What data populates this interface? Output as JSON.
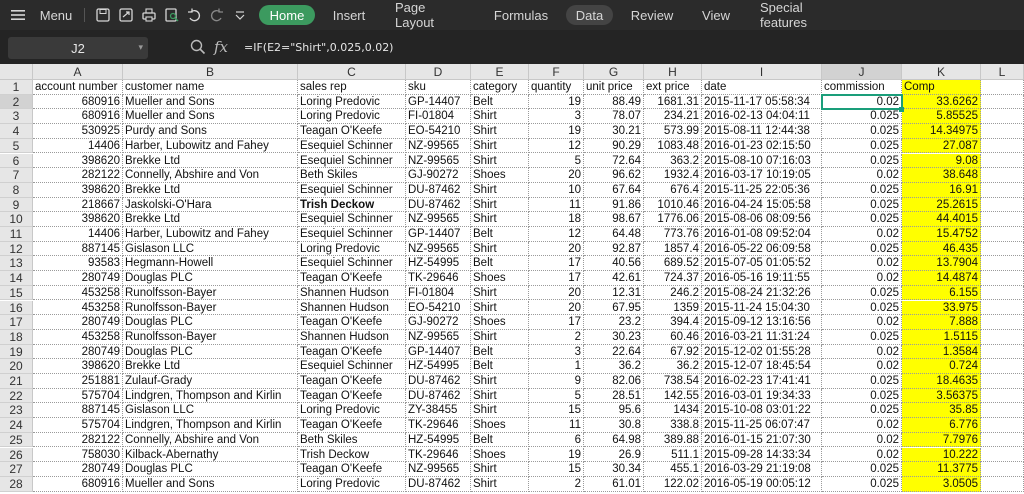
{
  "toolbar": {
    "menu_label": "Menu",
    "tabs": [
      "Home",
      "Insert",
      "Page Layout",
      "Formulas",
      "Data",
      "Review",
      "View",
      "Special features"
    ],
    "active_tab": "Home",
    "accent": "#3c9a5f"
  },
  "formula_bar": {
    "cell_ref": "J2",
    "fx_label": "fx",
    "formula": "=IF(E2=\"Shirt\",0.025,0.02)"
  },
  "sheet": {
    "columns": [
      "A",
      "B",
      "C",
      "D",
      "E",
      "F",
      "G",
      "H",
      "I",
      "J",
      "K",
      "L"
    ],
    "selected_column": "J",
    "selected_row": 2,
    "highlight_color": "#ffff00",
    "rows": [
      {
        "n": "1",
        "c": [
          "account number",
          "customer name",
          "sales rep",
          "sku",
          "category",
          "quantity",
          "unit price",
          "ext price",
          "date",
          "commission",
          "Comp"
        ]
      },
      {
        "n": "2",
        "c": [
          "680916",
          "Mueller and Sons",
          "Loring Predovic",
          "GP-14407",
          "Belt",
          "19",
          "88.49",
          "1681.31",
          "2015-11-17 05:58:34",
          "0.02",
          "33.6262"
        ]
      },
      {
        "n": "3",
        "c": [
          "680916",
          "Mueller and Sons",
          "Loring Predovic",
          "FI-01804",
          "Shirt",
          "3",
          "78.07",
          "234.21",
          "2016-02-13 04:04:11",
          "0.025",
          "5.85525"
        ]
      },
      {
        "n": "4",
        "c": [
          "530925",
          "Purdy and Sons",
          "Teagan O'Keefe",
          "EO-54210",
          "Shirt",
          "19",
          "30.21",
          "573.99",
          "2015-08-11 12:44:38",
          "0.025",
          "14.34975"
        ]
      },
      {
        "n": "5",
        "c": [
          "14406",
          "Harber, Lubowitz and Fahey",
          "Esequiel Schinner",
          "NZ-99565",
          "Shirt",
          "12",
          "90.29",
          "1083.48",
          "2016-01-23 02:15:50",
          "0.025",
          "27.087"
        ]
      },
      {
        "n": "6",
        "c": [
          "398620",
          "Brekke Ltd",
          "Esequiel Schinner",
          "NZ-99565",
          "Shirt",
          "5",
          "72.64",
          "363.2",
          "2015-08-10 07:16:03",
          "0.025",
          "9.08"
        ]
      },
      {
        "n": "7",
        "c": [
          "282122",
          "Connelly, Abshire and Von",
          "Beth Skiles",
          "GJ-90272",
          "Shoes",
          "20",
          "96.62",
          "1932.4",
          "2016-03-17 10:19:05",
          "0.02",
          "38.648"
        ]
      },
      {
        "n": "8",
        "c": [
          "398620",
          "Brekke Ltd",
          "Esequiel Schinner",
          "DU-87462",
          "Shirt",
          "10",
          "67.64",
          "676.4",
          "2015-11-25 22:05:36",
          "0.025",
          "16.91"
        ]
      },
      {
        "n": "9",
        "c": [
          "218667",
          "Jaskolski-O'Hara",
          "Trish Deckow",
          "DU-87462",
          "Shirt",
          "11",
          "91.86",
          "1010.46",
          "2016-04-24 15:05:58",
          "0.025",
          "25.2615"
        ],
        "bold": 2
      },
      {
        "n": "10",
        "c": [
          "398620",
          "Brekke Ltd",
          "Esequiel Schinner",
          "NZ-99565",
          "Shirt",
          "18",
          "98.67",
          "1776.06",
          "2015-08-06 08:09:56",
          "0.025",
          "44.4015"
        ]
      },
      {
        "n": "11",
        "c": [
          "14406",
          "Harber, Lubowitz and Fahey",
          "Esequiel Schinner",
          "GP-14407",
          "Belt",
          "12",
          "64.48",
          "773.76",
          "2016-01-08 09:52:04",
          "0.02",
          "15.4752"
        ]
      },
      {
        "n": "12",
        "c": [
          "887145",
          "Gislason LLC",
          "Loring Predovic",
          "NZ-99565",
          "Shirt",
          "20",
          "92.87",
          "1857.4",
          "2016-05-22 06:09:58",
          "0.025",
          "46.435"
        ]
      },
      {
        "n": "13",
        "c": [
          "93583",
          "Hegmann-Howell",
          "Esequiel Schinner",
          "HZ-54995",
          "Belt",
          "17",
          "40.56",
          "689.52",
          "2015-07-05 01:05:52",
          "0.02",
          "13.7904"
        ]
      },
      {
        "n": "14",
        "c": [
          "280749",
          "Douglas PLC",
          "Teagan O'Keefe",
          "TK-29646",
          "Shoes",
          "17",
          "42.61",
          "724.37",
          "2016-05-16 19:11:55",
          "0.02",
          "14.4874"
        ]
      },
      {
        "n": "15",
        "c": [
          "453258",
          "Runolfsson-Bayer",
          "Shannen Hudson",
          "FI-01804",
          "Shirt",
          "20",
          "12.31",
          "246.2",
          "2015-08-24 21:32:26",
          "0.025",
          "6.155"
        ]
      },
      {
        "n": "16",
        "c": [
          "453258",
          "Runolfsson-Bayer",
          "Shannen Hudson",
          "EO-54210",
          "Shirt",
          "20",
          "67.95",
          "1359",
          "2015-11-24 15:04:30",
          "0.025",
          "33.975"
        ]
      },
      {
        "n": "17",
        "c": [
          "280749",
          "Douglas PLC",
          "Teagan O'Keefe",
          "GJ-90272",
          "Shoes",
          "17",
          "23.2",
          "394.4",
          "2015-09-12 13:16:56",
          "0.02",
          "7.888"
        ]
      },
      {
        "n": "18",
        "c": [
          "453258",
          "Runolfsson-Bayer",
          "Shannen Hudson",
          "NZ-99565",
          "Shirt",
          "2",
          "30.23",
          "60.46",
          "2016-03-21 11:31:24",
          "0.025",
          "1.5115"
        ]
      },
      {
        "n": "19",
        "c": [
          "280749",
          "Douglas PLC",
          "Teagan O'Keefe",
          "GP-14407",
          "Belt",
          "3",
          "22.64",
          "67.92",
          "2015-12-02 01:55:28",
          "0.02",
          "1.3584"
        ]
      },
      {
        "n": "20",
        "c": [
          "398620",
          "Brekke Ltd",
          "Esequiel Schinner",
          "HZ-54995",
          "Belt",
          "1",
          "36.2",
          "36.2",
          "2015-12-07 18:45:54",
          "0.02",
          "0.724"
        ]
      },
      {
        "n": "21",
        "c": [
          "251881",
          "Zulauf-Grady",
          "Teagan O'Keefe",
          "DU-87462",
          "Shirt",
          "9",
          "82.06",
          "738.54",
          "2016-02-23 17:41:41",
          "0.025",
          "18.4635"
        ]
      },
      {
        "n": "22",
        "c": [
          "575704",
          "Lindgren, Thompson and Kirlin",
          "Teagan O'Keefe",
          "DU-87462",
          "Shirt",
          "5",
          "28.51",
          "142.55",
          "2016-03-01 19:34:33",
          "0.025",
          "3.56375"
        ]
      },
      {
        "n": "23",
        "c": [
          "887145",
          "Gislason LLC",
          "Loring Predovic",
          "ZY-38455",
          "Shirt",
          "15",
          "95.6",
          "1434",
          "2015-10-08 03:01:22",
          "0.025",
          "35.85"
        ]
      },
      {
        "n": "24",
        "c": [
          "575704",
          "Lindgren, Thompson and Kirlin",
          "Teagan O'Keefe",
          "TK-29646",
          "Shoes",
          "11",
          "30.8",
          "338.8",
          "2015-11-25 06:07:47",
          "0.02",
          "6.776"
        ]
      },
      {
        "n": "25",
        "c": [
          "282122",
          "Connelly, Abshire and Von",
          "Beth Skiles",
          "HZ-54995",
          "Belt",
          "6",
          "64.98",
          "389.88",
          "2016-01-15 21:07:30",
          "0.02",
          "7.7976"
        ]
      },
      {
        "n": "26",
        "c": [
          "758030",
          "Kilback-Abernathy",
          "Trish Deckow",
          "TK-29646",
          "Shoes",
          "19",
          "26.9",
          "511.1",
          "2015-09-28 14:33:34",
          "0.02",
          "10.222"
        ]
      },
      {
        "n": "27",
        "c": [
          "280749",
          "Douglas PLC",
          "Teagan O'Keefe",
          "NZ-99565",
          "Shirt",
          "15",
          "30.34",
          "455.1",
          "2016-03-29 21:19:08",
          "0.025",
          "11.3775"
        ]
      },
      {
        "n": "28",
        "c": [
          "680916",
          "Mueller and Sons",
          "Loring Predovic",
          "DU-87462",
          "Shirt",
          "2",
          "61.01",
          "122.02",
          "2016-05-19 00:05:12",
          "0.025",
          "3.0505"
        ]
      }
    ]
  }
}
